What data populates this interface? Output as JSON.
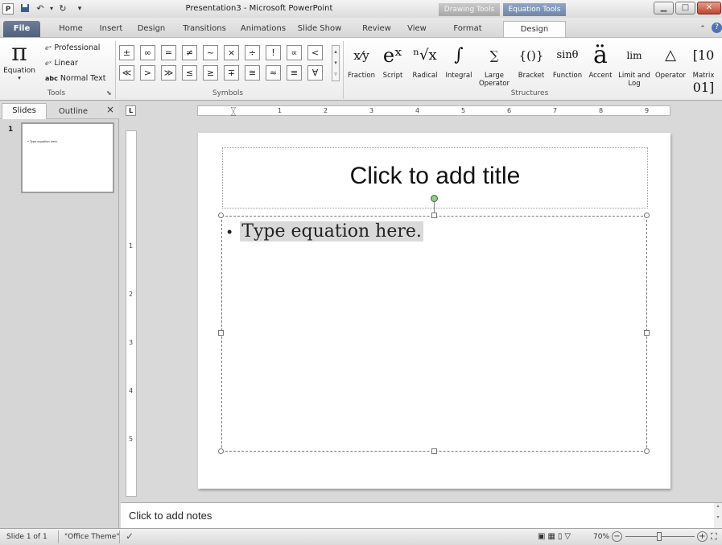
{
  "window": {
    "title": "Presentation3 - Microsoft PowerPoint"
  },
  "quick_access": {
    "app_icon": "P",
    "save_icon": "save-icon",
    "undo_icon": "↶",
    "redo_icon": "↻",
    "customize_icon": "▾"
  },
  "contextual_tabs": {
    "drawing_tools": "Drawing Tools",
    "equation_tools": "Equation Tools"
  },
  "window_controls": {
    "minimize": "▁",
    "maximize": "□",
    "close": "✕"
  },
  "tabs": {
    "file": "File",
    "home": "Home",
    "insert": "Insert",
    "design": "Design",
    "transitions": "Transitions",
    "animations": "Animations",
    "slide_show": "Slide Show",
    "review": "Review",
    "view": "View",
    "format": "Format",
    "eq_design": "Design"
  },
  "ribbon": {
    "tools": {
      "equation_glyph": "π",
      "equation_label": "Equation",
      "professional": "Professional",
      "linear": "Linear",
      "normal_text": "Normal Text",
      "normal_text_prefix": "abc",
      "group_label": "Tools"
    },
    "symbols": {
      "row1": [
        "±",
        "∞",
        "=",
        "≠",
        "~",
        "×",
        "÷",
        "!",
        "∝",
        "<"
      ],
      "row2": [
        "≪",
        ">",
        "≫",
        "≤",
        "≥",
        "∓",
        "≅",
        "≈",
        "≡",
        "∀"
      ],
      "group_label": "Symbols"
    },
    "structures": {
      "items": [
        {
          "glyph": "x⁄y",
          "label": "Fraction"
        },
        {
          "glyph": "eˣ",
          "label": "Script"
        },
        {
          "glyph": "ⁿ√x",
          "label": "Radical"
        },
        {
          "glyph": "∫",
          "label": "Integral"
        },
        {
          "glyph": "∑",
          "label": "Large Operator"
        },
        {
          "glyph": "{()}",
          "label": "Bracket"
        },
        {
          "glyph": "sinθ",
          "label": "Function"
        },
        {
          "glyph": "ä",
          "label": "Accent"
        },
        {
          "glyph": "lim",
          "label": "Limit and Log"
        },
        {
          "glyph": "△",
          "label": "Operator"
        },
        {
          "glyph": "[10 01]",
          "label": "Matrix"
        }
      ],
      "group_label": "Structures"
    }
  },
  "left_panel": {
    "tab_slides": "Slides",
    "tab_outline": "Outline",
    "close": "×",
    "slide_number": "1",
    "thumb_text": "• Type equation here."
  },
  "slide": {
    "title_placeholder": "Click to add title",
    "bullet": "•",
    "equation_text": "Type equation here."
  },
  "ruler": {
    "h_numbers": [
      "1",
      "2",
      "3",
      "4",
      "5",
      "6",
      "7",
      "8",
      "9"
    ],
    "v_numbers": [
      "1",
      "2",
      "3",
      "4",
      "5"
    ],
    "corner": "L"
  },
  "notes": {
    "placeholder": "Click to add notes"
  },
  "status": {
    "slide_info": "Slide 1 of 1",
    "theme": "\"Office Theme\"",
    "zoom": "70%",
    "zoom_minus": "−",
    "zoom_plus": "+"
  }
}
